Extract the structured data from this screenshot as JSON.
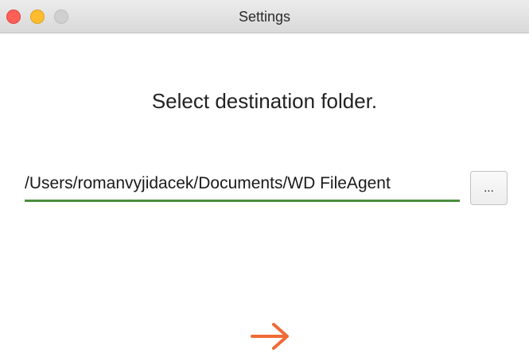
{
  "window": {
    "title": "Settings"
  },
  "main": {
    "heading": "Select destination folder.",
    "destination_path": "/Users/romanvyjidacek/Documents/WD FileAgent",
    "browse_label": "...",
    "next_icon": "arrow-right-icon"
  },
  "colors": {
    "accent_underline": "#4a8f3c",
    "next_arrow": "#f06a35"
  }
}
